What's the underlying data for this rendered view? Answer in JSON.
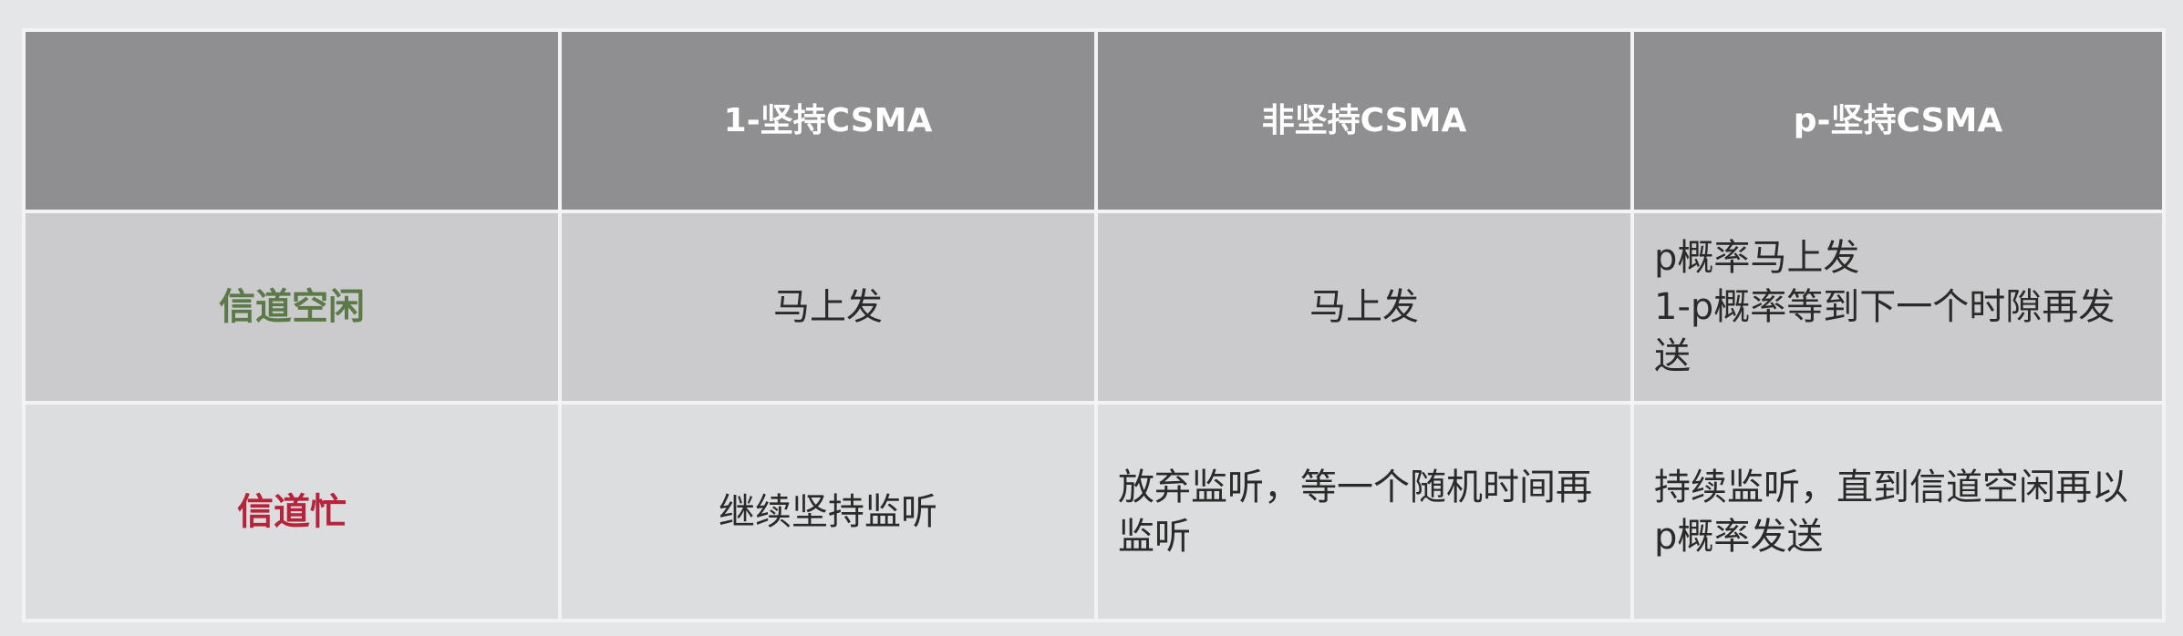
{
  "table": {
    "headers": [
      "",
      "1-坚持CSMA",
      "非坚持CSMA",
      "p-坚持CSMA"
    ],
    "rows": [
      {
        "label": "信道空闲",
        "cells": [
          "马上发",
          "马上发",
          "p概率马上发\n1-p概率等到下一个时隙再发送"
        ]
      },
      {
        "label": "信道忙",
        "cells": [
          "继续坚持监听",
          "放弃监听，等一个随机时间再监听",
          "持续监听，直到信道空闲再以p概率发送"
        ]
      }
    ]
  },
  "colors": {
    "idle_label": "#5c7a48",
    "busy_label": "#b5243a",
    "header_bg": "#8f8f91"
  }
}
